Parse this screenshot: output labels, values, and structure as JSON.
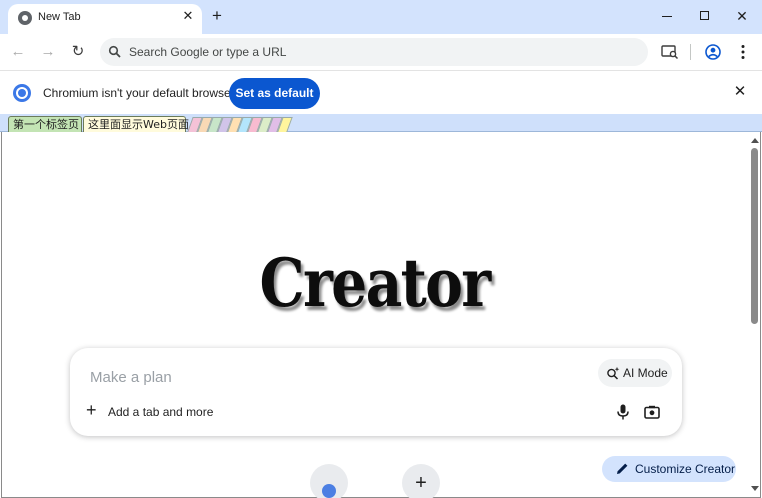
{
  "browser": {
    "tab": {
      "title": "New Tab"
    },
    "window_controls": {
      "minimize": "minimize",
      "maximize": "maximize",
      "close": "✕"
    }
  },
  "toolbar": {
    "back_icon": "←",
    "forward_icon": "→",
    "reload_icon": "↻",
    "omnibox_placeholder": "Search Google or type a URL"
  },
  "infobar": {
    "message": "Chromium isn't your default browser",
    "button_label": "Set as default",
    "close": "✕"
  },
  "page_tabs": [
    {
      "label": "第一个标签页"
    },
    {
      "label": "这里面显示Web页面"
    }
  ],
  "page_tab_stripe_colors": [
    "#f4c2d7",
    "#f9d9b5",
    "#c8e6c9",
    "#d1c4e9",
    "#ffe0b2",
    "#b3e5fc",
    "#f8bbd0",
    "#dcedc8",
    "#e1bee7",
    "#fff59d"
  ],
  "ntp": {
    "logo_text": "Creator",
    "search_placeholder": "Make a plan",
    "ai_mode_label": "AI Mode",
    "add_tab_label": "Add a tab and more",
    "customize_label": "Customize Creator"
  },
  "colors": {
    "accent": "#0b57d0",
    "tabstrip": "#d3e3fd",
    "customize_bg": "#d3e3fd"
  }
}
